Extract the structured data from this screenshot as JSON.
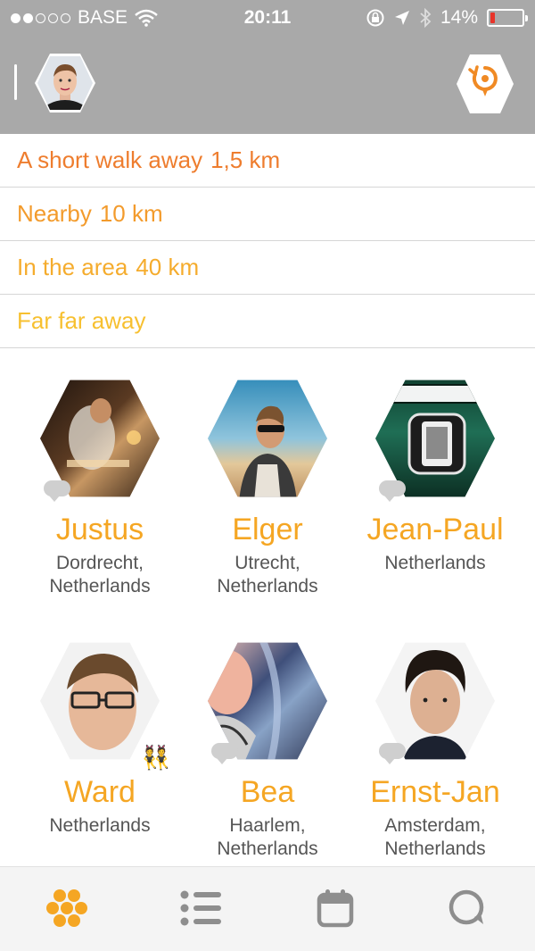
{
  "status_bar": {
    "carrier": "BASE",
    "time": "20:11",
    "battery_percent": "14%",
    "signal_dots_total": 5,
    "signal_dots_filled": 2,
    "battery_fraction": 0.14
  },
  "header": {
    "profile_icon": "profile-avatar",
    "location_icon": "location-refresh-icon",
    "menu_icon": "menu-bar-icon"
  },
  "distances": [
    {
      "label": "A short walk away",
      "value": "1,5 km",
      "color": "#ee7d2e"
    },
    {
      "label": "Nearby",
      "value": "10 km",
      "color": "#f39b2c"
    },
    {
      "label": "In the area",
      "value": "40 km",
      "color": "#f5ac2d"
    },
    {
      "label": "Far far away",
      "value": "",
      "color": "#f7c030"
    }
  ],
  "people": [
    {
      "name": "Justus",
      "location_line1": "Dordrecht,",
      "location_line2": "Netherlands",
      "chat": true
    },
    {
      "name": "Elger",
      "location_line1": "Utrecht,",
      "location_line2": "Netherlands",
      "chat": false
    },
    {
      "name": "Jean-Paul",
      "location_line1": "Netherlands",
      "location_line2": "",
      "chat": true
    },
    {
      "name": "Ward",
      "location_line1": "Netherlands",
      "location_line2": "",
      "chat": false,
      "emoji": "👯"
    },
    {
      "name": "Bea",
      "location_line1": "Haarlem,",
      "location_line2": "Netherlands",
      "chat": true
    },
    {
      "name": "Ernst-Jan",
      "location_line1": "Amsterdam,",
      "location_line2": "Netherlands",
      "chat": true
    }
  ],
  "tabs": [
    {
      "name": "people-grid",
      "icon": "hive-icon",
      "active": true
    },
    {
      "name": "list",
      "icon": "list-icon",
      "active": false
    },
    {
      "name": "calendar",
      "icon": "calendar-icon",
      "active": false
    },
    {
      "name": "chat",
      "icon": "chat-icon",
      "active": false
    }
  ],
  "colors": {
    "header_bg": "#a9a9a9",
    "accent": "#f5a623",
    "active_tab": "#f5a623",
    "inactive_tab": "#8e8e8e"
  }
}
